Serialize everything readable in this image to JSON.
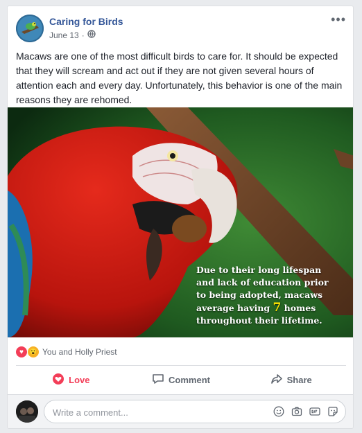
{
  "post": {
    "page_name": "Caring for Birds",
    "date": "June 13",
    "body": "Macaws are one of the most difficult birds to care for. It should be expected that they will scream and act out if they are not given several hours of attention each and every day. Unfortunately, this behavior is one of the main reasons they are rehomed.",
    "image_caption": {
      "line1": "Due to their long lifespan",
      "line2": "and lack of education prior",
      "line3": "to being adopted, macaws",
      "line4_pre": "average having ",
      "line4_num": "7",
      "line4_post": " homes",
      "line5": "throughout their lifetime."
    }
  },
  "reactions": {
    "summary": "You and Holly Priest"
  },
  "actions": {
    "love": "Love",
    "comment": "Comment",
    "share": "Share"
  },
  "comment": {
    "placeholder": "Write a comment..."
  },
  "icons": {
    "more": "more-horizontal-icon",
    "audience": "globe-icon",
    "reaction_love": "heart-icon",
    "reaction_wow": "wow-icon",
    "emoji": "emoji-icon",
    "camera": "camera-icon",
    "gif": "gif-icon",
    "sticker": "sticker-icon"
  },
  "colors": {
    "link": "#365899",
    "love": "#f33e58",
    "wow": "#f7b125",
    "muted": "#606770"
  }
}
